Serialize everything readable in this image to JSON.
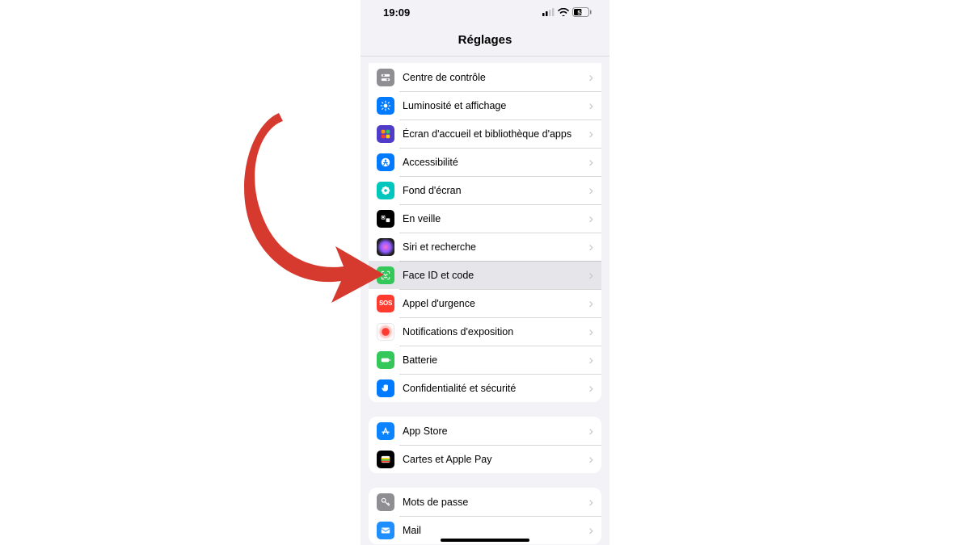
{
  "status": {
    "time": "19:09",
    "battery_text": "53"
  },
  "nav": {
    "title": "Réglages"
  },
  "groups": [
    {
      "rows": [
        {
          "icon": "control-center-icon",
          "bg": "#8e8e93",
          "label": "Centre de contrôle"
        },
        {
          "icon": "brightness-icon",
          "bg": "#007aff",
          "label": "Luminosité et affichage"
        },
        {
          "icon": "homescreen-icon",
          "bg": "#4f3cc9",
          "label": "Écran d'accueil et bibliothèque d'apps"
        },
        {
          "icon": "accessibility-icon",
          "bg": "#007aff",
          "label": "Accessibilité"
        },
        {
          "icon": "wallpaper-icon",
          "bg": "#00c7be",
          "label": "Fond d'écran"
        },
        {
          "icon": "standby-icon",
          "bg": "#000000",
          "label": "En veille"
        },
        {
          "icon": "siri-icon",
          "bg": "siri",
          "label": "Siri et recherche"
        },
        {
          "icon": "faceid-icon",
          "bg": "#34c759",
          "label": "Face ID et code",
          "highlight": true
        },
        {
          "icon": "sos-icon",
          "bg": "#ff3b30",
          "label": "Appel d'urgence",
          "text": "SOS"
        },
        {
          "icon": "exposure-icon",
          "bg": "exposure",
          "label": "Notifications d'exposition"
        },
        {
          "icon": "battery-icon",
          "bg": "#34c759",
          "label": "Batterie"
        },
        {
          "icon": "privacy-icon",
          "bg": "#007aff",
          "label": "Confidentialité et sécurité"
        }
      ]
    },
    {
      "rows": [
        {
          "icon": "appstore-icon",
          "bg": "#0d84ff",
          "label": "App Store"
        },
        {
          "icon": "wallet-icon",
          "bg": "#000000",
          "label": "Cartes et Apple Pay"
        }
      ]
    },
    {
      "rows": [
        {
          "icon": "passwords-icon",
          "bg": "#8e8e93",
          "label": "Mots de passe"
        },
        {
          "icon": "mail-icon",
          "bg": "#1f8fff",
          "label": "Mail"
        }
      ]
    }
  ],
  "icons": {
    "control-center-icon": "toggles",
    "brightness-icon": "sun",
    "homescreen-icon": "grid",
    "accessibility-icon": "person",
    "wallpaper-icon": "flower",
    "standby-icon": "clock-square",
    "siri-icon": "orb",
    "faceid-icon": "faceid",
    "sos-icon": "text",
    "exposure-icon": "reddot",
    "battery-icon": "battery",
    "privacy-icon": "hand",
    "appstore-icon": "a-logo",
    "wallet-icon": "wallet",
    "passwords-icon": "key",
    "mail-icon": "envelope"
  }
}
